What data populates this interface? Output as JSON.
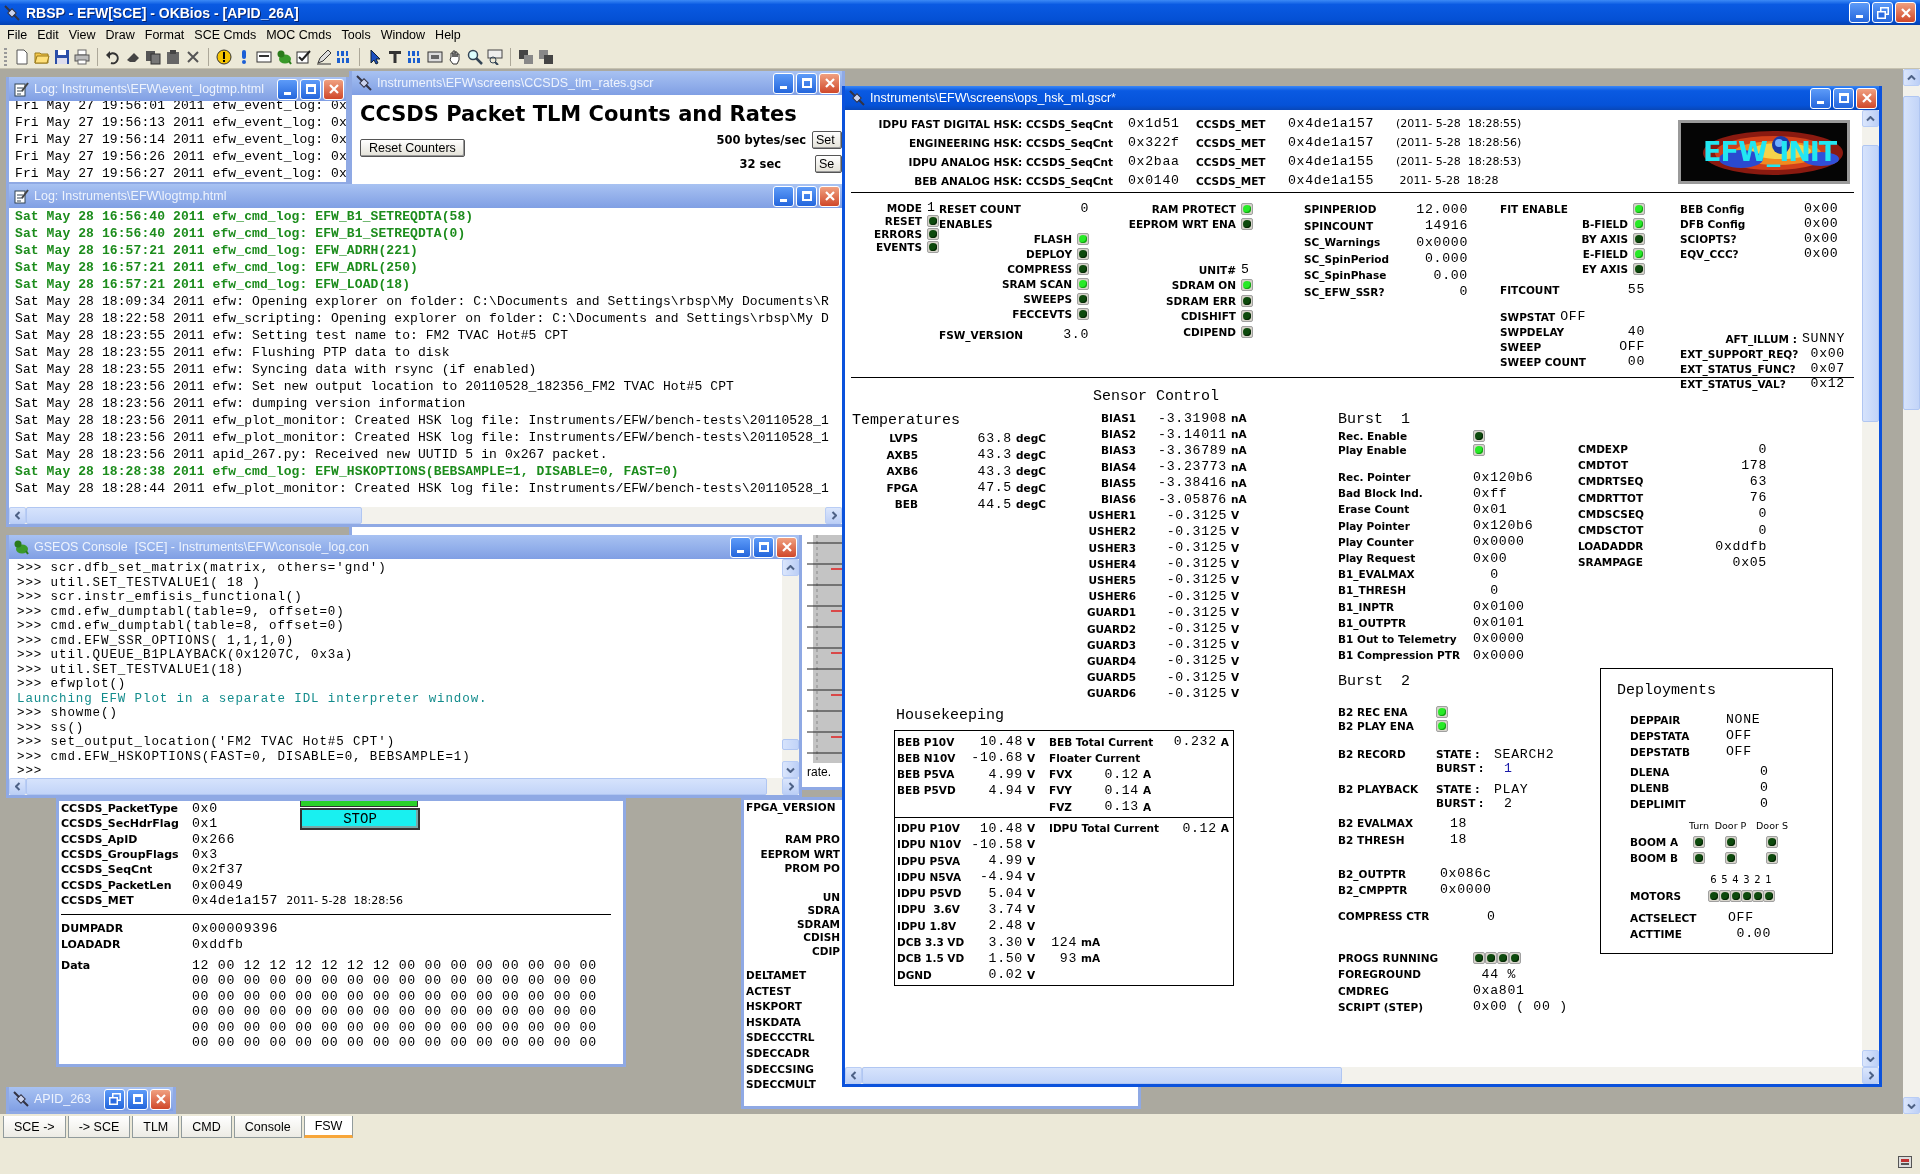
{
  "app": {
    "title": "RBSP - EFW[SCE] - OKBios - [APID_26A]",
    "menu": [
      "File",
      "Edit",
      "View",
      "Draw",
      "Format",
      "SCE Cmds",
      "MOC Cmds",
      "Tools",
      "Window",
      "Help"
    ]
  },
  "windows": [
    {
      "kind": "event_log",
      "title": "Log: Instruments\\EFW\\event_logtmp.html",
      "active": false,
      "lines": [
        {
          "text": "Fri May 27 19:56:01 2011 efw_event_log: 0x",
          "command": false
        },
        {
          "text": "Fri May 27 19:56:13 2011 efw_event_log: 0x",
          "command": false
        },
        {
          "text": "Fri May 27 19:56:14 2011 efw_event_log: 0x",
          "command": false
        },
        {
          "text": "Fri May 27 19:56:26 2011 efw_event_log: 0x",
          "command": false
        },
        {
          "text": "Fri May 27 19:56:27 2011 efw_event_log: 0x",
          "command": false
        }
      ]
    },
    {
      "kind": "tlm_rates",
      "title": "Instruments\\EFW\\screens\\CCSDS_tlm_rates.gscr",
      "active": false,
      "heading": "CCSDS Packet TLM Counts and Rates",
      "reset_button": "Reset Counters",
      "rates": [
        {
          "text": "500 bytes/sec",
          "button": "Set"
        },
        {
          "text": "32 sec",
          "button": "Se"
        }
      ],
      "caption": "rate."
    },
    {
      "kind": "log",
      "title": "Log: Instruments\\EFW\\logtmp.html",
      "active": false,
      "lines": [
        {
          "text": "Sat May 28 16:56:40 2011 efw_cmd_log: EFW_B1_SETREQDTA(58)",
          "command": true
        },
        {
          "text": "Sat May 28 16:56:40 2011 efw_cmd_log: EFW_B1_SETREQDTA(0)",
          "command": true
        },
        {
          "text": "Sat May 28 16:57:21 2011 efw_cmd_log: EFW_ADRH(221)",
          "command": true
        },
        {
          "text": "Sat May 28 16:57:21 2011 efw_cmd_log: EFW_ADRL(250)",
          "command": true
        },
        {
          "text": "Sat May 28 16:57:21 2011 efw_cmd_log: EFW_LOAD(18)",
          "command": true
        },
        {
          "text": "Sat May 28 18:09:34 2011 efw: Opening explorer on folder: C:\\Documents and Settings\\rbsp\\My Documents\\R",
          "command": false
        },
        {
          "text": "Sat May 28 18:22:58 2011 efw_scripting: Opening explorer on folder: C:\\Documents and Settings\\rbsp\\My D",
          "command": false
        },
        {
          "text": "Sat May 28 18:23:55 2011 efw: Setting test name to: FM2 TVAC Hot#5 CPT",
          "command": false
        },
        {
          "text": "Sat May 28 18:23:55 2011 efw: Flushing PTP data to disk",
          "command": false
        },
        {
          "text": "Sat May 28 18:23:55 2011 efw: Syncing data with rsync (if enabled)",
          "command": false
        },
        {
          "text": "Sat May 28 18:23:56 2011 efw: Set new output location to 20110528_182356_FM2 TVAC Hot#5 CPT",
          "command": false
        },
        {
          "text": "Sat May 28 18:23:56 2011 efw: dumping version information",
          "command": false
        },
        {
          "text": "Sat May 28 18:23:56 2011 efw_plot_monitor: Created HSK log file: Instruments/EFW/bench-tests\\20110528_1",
          "command": false
        },
        {
          "text": "Sat May 28 18:23:56 2011 efw_plot_monitor: Created HSK log file: Instruments/EFW/bench-tests\\20110528_1",
          "command": false
        },
        {
          "text": "Sat May 28 18:23:56 2011 apid_267.py: Received new UUTID 5 in 0x267 packet.",
          "command": false
        },
        {
          "text": "Sat May 28 18:28:38 2011 efw_cmd_log: EFW_HSKOPTIONS(BEBSAMPLE=1, DISABLE=0, FAST=0)",
          "command": true
        },
        {
          "text": "Sat May 28 18:28:44 2011 efw_plot_monitor: Created HSK log file: Instruments/EFW/bench-tests\\20110528_1",
          "command": false
        }
      ]
    },
    {
      "kind": "packet",
      "active": false,
      "fields": [
        {
          "label": "CCSDS_PacketType",
          "value": "0x0"
        },
        {
          "label": "CCSDS_SecHdrFlag",
          "value": "0x1"
        },
        {
          "label": "CCSDS_ApID",
          "value": "0x266"
        },
        {
          "label": "CCSDS_GroupFlags",
          "value": "0x3"
        },
        {
          "label": "CCSDS_SeqCnt",
          "value": "0x2f37"
        },
        {
          "label": "CCSDS_PacketLen",
          "value": "0x0049"
        },
        {
          "label": "CCSDS_MET",
          "value": "0x4de1a157",
          "time": "2011- 5-28  18:28:56"
        }
      ],
      "button": "STOP",
      "addresses": [
        {
          "label": "DUMPADR",
          "value": "0x00009396"
        },
        {
          "label": "LOADADR",
          "value": "0xddfb"
        }
      ],
      "data_label": "Data",
      "data": [
        "12 00 12 12 12 12 12 12 00 00 00 00 00 00 00 00",
        "00 00 00 00 00 00 00 00 00 00 00 00 00 00 00 00",
        "00 00 00 00 00 00 00 00 00 00 00 00 00 00 00 00",
        "00 00 00 00 00 00 00 00 00 00 00 00 00 00 00 00",
        "00 00 00 00 00 00 00 00 00 00 00 00 00 00 00 00",
        "00 00 00 00 00 00 00 00 00 00 00 00 00 00 00 00"
      ]
    },
    {
      "kind": "fsw",
      "active": false,
      "top_labels": [
        "FPGA_VERSION"
      ],
      "enable_labels": [
        "RAM PRO",
        "EEPROM WRT",
        "PROM PO"
      ],
      "unit_labels": [
        "UN",
        "SDRA",
        "SDRAM",
        "CDISH",
        "CDIP"
      ],
      "register_labels": [
        "DELTAMET",
        "ACTEST",
        "HSKPORT",
        "HSKDATA",
        "SDECCCTRL",
        "SDECCADR",
        "SDECCSING",
        "SDECCMULT"
      ]
    },
    {
      "kind": "console",
      "title": "GSEOS Console  [SCE] - Instruments\\EFW\\console_log.con",
      "active": false,
      "lines": [
        {
          "text": ">>> scr.dfb_set_matrix(matrix, others='gnd')",
          "output": false
        },
        {
          "text": ">>> util.SET_TESTVALUE1( 18 )",
          "output": false
        },
        {
          "text": ">>> scr.instr_emfisis_functional()",
          "output": false
        },
        {
          "text": ">>> cmd.efw_dumptabl(table=9, offset=0)",
          "output": false
        },
        {
          "text": ">>> cmd.efw_dumptabl(table=8, offset=0)",
          "output": false
        },
        {
          "text": ">>> cmd.EFW_SSR_OPTIONS( 1,1,1,0)",
          "output": false
        },
        {
          "text": ">>> util.QUEUE_B1PLAYBACK(0x1207C, 0x3a)",
          "output": false
        },
        {
          "text": ">>> util.SET_TESTVALUE1(18)",
          "output": false
        },
        {
          "text": ">>> efwplot()",
          "output": false
        },
        {
          "text": "Launching EFW Plot in a separate IDL interpreter window.",
          "output": true
        },
        {
          "text": ">>> showme()",
          "output": false
        },
        {
          "text": ">>> ss()",
          "output": false
        },
        {
          "text": ">>> set_output_location('FM2 TVAC Hot#5 CPT')",
          "output": false
        },
        {
          "text": ">>> cmd.EFW_HSKOPTIONS(FAST=0, DISABLE=0, BEBSAMPLE=1)",
          "output": false
        },
        {
          "text": ">>>",
          "output": false
        }
      ]
    },
    {
      "kind": "minimized",
      "title": "APID_263",
      "active": false
    },
    {
      "kind": "hsk",
      "title": "Instruments\\EFW\\screens\\ops_hsk_ml.gscr*",
      "active": true,
      "packets": [
        {
          "label": "IDPU FAST DIGITAL HSK: CCSDS_SeqCnt",
          "seq": "0x1d51",
          "met_label": "CCSDS_MET",
          "met": "0x4de1a157",
          "time": "(2011- 5-28  18:28:55)"
        },
        {
          "label": "ENGINEERING HSK: CCSDS_SeqCnt",
          "seq": "0x322f",
          "met_label": "CCSDS_MET",
          "met": "0x4de1a157",
          "time": "(2011- 5-28  18:28:56)"
        },
        {
          "label": "IDPU ANALOG HSK: CCSDS_SeqCnt",
          "seq": "0x2baa",
          "met_label": "CCSDS_MET",
          "met": "0x4de1a155",
          "time": "(2011- 5-28  18:28:53)"
        },
        {
          "label": "BEB ANALOG HSK: CCSDS_SeqCnt",
          "seq": "0x0140",
          "met_label": "CCSDS_MET",
          "met": "0x4de1a155",
          "time": " 2011- 5-28  18:28"
        }
      ],
      "logo": "EFW_INIT",
      "status_columns": [
        [
          {
            "kind": "value",
            "label": "MODE",
            "value": "1"
          },
          {
            "kind": "led",
            "label": "RESET",
            "on": false
          },
          {
            "kind": "led",
            "label": "ERRORS",
            "on": false
          },
          {
            "kind": "led",
            "label": "EVENTS",
            "on": false
          }
        ],
        [
          {
            "kind": "value",
            "label": "RESET COUNT",
            "value": "0"
          },
          {
            "kind": "heading",
            "label": "ENABLES"
          },
          {
            "kind": "led",
            "label": "FLASH",
            "on": true
          },
          {
            "kind": "led",
            "label": "DEPLOY",
            "on": false
          },
          {
            "kind": "led",
            "label": "COMPRESS",
            "on": false
          },
          {
            "kind": "led",
            "label": "SRAM SCAN",
            "on": true
          },
          {
            "kind": "led",
            "label": "SWEEPS",
            "on": false
          },
          {
            "kind": "led",
            "label": "FECCEVTS",
            "on": false
          },
          {
            "kind": "value",
            "label": "FSW_VERSION",
            "value": "3.0"
          }
        ],
        [
          {
            "kind": "led",
            "label": "RAM PROTECT",
            "on": true
          },
          {
            "kind": "led",
            "label": "EEPROM WRT ENA",
            "on": false
          },
          {
            "kind": "value",
            "label": "UNIT#",
            "value": "5"
          },
          {
            "kind": "led",
            "label": "SDRAM ON",
            "on": true
          },
          {
            "kind": "led",
            "label": "SDRAM ERR",
            "on": false
          },
          {
            "kind": "led",
            "label": "CDISHIFT",
            "on": false
          },
          {
            "kind": "led",
            "label": "CDIPEND",
            "on": false
          }
        ],
        [
          {
            "kind": "value",
            "label": "SPINPERIOD",
            "value": "12.000"
          },
          {
            "kind": "value",
            "label": "SPINCOUNT",
            "value": "14916"
          },
          {
            "kind": "value",
            "label": "SC_Warnings",
            "value": "0x0000"
          },
          {
            "kind": "value",
            "label": "SC_SpinPeriod",
            "value": "0.000"
          },
          {
            "kind": "value",
            "label": "SC_SpinPhase",
            "value": "0.00"
          },
          {
            "kind": "value",
            "label": "SC_EFW_SSR?",
            "value": "0"
          }
        ],
        [
          {
            "kind": "led",
            "label": "FIT ENABLE",
            "on": true
          },
          {
            "kind": "led",
            "label": "B-FIELD",
            "on": true
          },
          {
            "kind": "led",
            "label": "BY AXIS",
            "on": false
          },
          {
            "kind": "led",
            "label": "E-FIELD",
            "on": true
          },
          {
            "kind": "led",
            "label": "EY AXIS",
            "on": false
          },
          {
            "kind": "value",
            "label": "FITCOUNT",
            "value": "55"
          },
          {
            "kind": "value",
            "label": "SWPSTAT",
            "value": "OFF"
          },
          {
            "kind": "value",
            "label": "SWPDELAY",
            "value": "40"
          },
          {
            "kind": "value",
            "label": "SWEEP",
            "value": "OFF"
          },
          {
            "kind": "value",
            "label": "SWEEP COUNT",
            "value": "00"
          }
        ],
        [
          {
            "kind": "value",
            "label": "BEB Config",
            "value": "0x00"
          },
          {
            "kind": "value",
            "label": "DFB Config",
            "value": "0x00"
          },
          {
            "kind": "value",
            "label": "SCIOPTS?",
            "value": "0x00"
          },
          {
            "kind": "value",
            "label": "EQV_CCC?",
            "value": "0x00"
          },
          {
            "kind": "value",
            "label": "AFT_ILLUM :",
            "value": "SUNNY"
          },
          {
            "kind": "value",
            "label": "EXT_SUPPORT_REQ?",
            "value": "0x00"
          },
          {
            "kind": "value",
            "label": "EXT_STATUS_FUNC?",
            "value": "0x07"
          },
          {
            "kind": "value",
            "label": "EXT_STATUS_VAL?",
            "value": "0x12"
          }
        ]
      ],
      "temperatures": {
        "title": "Temperatures",
        "rows": [
          {
            "label": "LVPS",
            "value": "63.8",
            "unit": "degC"
          },
          {
            "label": "AXB5",
            "value": "43.3",
            "unit": "degC"
          },
          {
            "label": "AXB6",
            "value": "43.3",
            "unit": "degC"
          },
          {
            "label": "FPGA",
            "value": "47.5",
            "unit": "degC"
          },
          {
            "label": "BEB",
            "value": "44.5",
            "unit": "degC"
          }
        ]
      },
      "sensor_control": {
        "title": "Sensor Control",
        "rows": [
          {
            "label": "BIAS1",
            "value": "-3.31908",
            "unit": "nA"
          },
          {
            "label": "BIAS2",
            "value": "-3.14011",
            "unit": "nA"
          },
          {
            "label": "BIAS3",
            "value": "-3.36789",
            "unit": "nA"
          },
          {
            "label": "BIAS4",
            "value": "-3.23773",
            "unit": "nA"
          },
          {
            "label": "BIAS5",
            "value": "-3.38416",
            "unit": "nA"
          },
          {
            "label": "BIAS6",
            "value": "-3.05876",
            "unit": "nA"
          },
          {
            "label": "USHER1",
            "value": "-0.3125",
            "unit": "V"
          },
          {
            "label": "USHER2",
            "value": "-0.3125",
            "unit": "V"
          },
          {
            "label": "USHER3",
            "value": "-0.3125",
            "unit": "V"
          },
          {
            "label": "USHER4",
            "value": "-0.3125",
            "unit": "V"
          },
          {
            "label": "USHER5",
            "value": "-0.3125",
            "unit": "V"
          },
          {
            "label": "USHER6",
            "value": "-0.3125",
            "unit": "V"
          },
          {
            "label": "GUARD1",
            "value": "-0.3125",
            "unit": "V"
          },
          {
            "label": "GUARD2",
            "value": "-0.3125",
            "unit": "V"
          },
          {
            "label": "GUARD3",
            "value": "-0.3125",
            "unit": "V"
          },
          {
            "label": "GUARD4",
            "value": "-0.3125",
            "unit": "V"
          },
          {
            "label": "GUARD5",
            "value": "-0.3125",
            "unit": "V"
          },
          {
            "label": "GUARD6",
            "value": "-0.3125",
            "unit": "V"
          }
        ]
      },
      "housekeeping": {
        "title": "Housekeeping",
        "beb": [
          {
            "label": "BEB P10V",
            "value": "10.48",
            "unit": "V"
          },
          {
            "label": "BEB N10V",
            "value": "-10.68",
            "unit": "V"
          },
          {
            "label": "BEB P5VA",
            "value": "4.99",
            "unit": "V"
          },
          {
            "label": "BEB P5VD",
            "value": "4.94",
            "unit": "V"
          }
        ],
        "beb_total": {
          "label": "BEB Total Current",
          "value": "0.232",
          "unit": "A"
        },
        "floater_title": "Floater Current",
        "floater": [
          {
            "label": "FVX",
            "value": "0.12",
            "unit": "A"
          },
          {
            "label": "FVY",
            "value": "0.14",
            "unit": "A"
          },
          {
            "label": "FVZ",
            "value": "0.13",
            "unit": "A"
          }
        ],
        "idpu": [
          {
            "label": "IDPU P10V",
            "value": "10.48",
            "unit": "V"
          },
          {
            "label": "IDPU N10V",
            "value": "-10.58",
            "unit": "V"
          },
          {
            "label": "IDPU P5VA",
            "value": "4.99",
            "unit": "V"
          },
          {
            "label": "IDPU N5VA",
            "value": "-4.94",
            "unit": "V"
          },
          {
            "label": "IDPU P5VD",
            "value": "5.04",
            "unit": "V"
          },
          {
            "label": "IDPU  3.6V",
            "value": "3.74",
            "unit": "V"
          },
          {
            "label": "IDPU 1.8V",
            "value": "2.48",
            "unit": "V"
          },
          {
            "label": "DCB 3.3 VD",
            "value": "3.30",
            "unit": "V",
            "current": "124",
            "current_unit": "mA"
          },
          {
            "label": "DCB 1.5 VD",
            "value": "1.50",
            "unit": "V",
            "current": "93",
            "current_unit": "mA"
          },
          {
            "label": "DGND",
            "value": "0.02",
            "unit": "V"
          }
        ],
        "idpu_total": {
          "label": "IDPU Total Current",
          "value": "0.12",
          "unit": "A"
        }
      },
      "burst1": {
        "title": "Burst  1",
        "leds": [
          {
            "label": "Rec. Enable",
            "on": false
          },
          {
            "label": "Play Enable",
            "on": true
          }
        ],
        "rows": [
          {
            "label": "Rec. Pointer",
            "value": "0x120b6"
          },
          {
            "label": "Bad Block Ind.",
            "value": "0xff"
          },
          {
            "label": "Erase Count",
            "value": "0x01"
          },
          {
            "label": "Play Pointer",
            "value": "0x120b6"
          },
          {
            "label": "Play Counter",
            "value": "0x0000"
          },
          {
            "label": "Play Request",
            "value": "0x00"
          },
          {
            "label": "B1_EVALMAX",
            "value": "  0"
          },
          {
            "label": "B1_THRESH",
            "value": "  0"
          },
          {
            "label": "B1_INPTR",
            "value": "0x0100"
          },
          {
            "label": "B1_OUTPTR",
            "value": "0x0101"
          },
          {
            "label": "B1 Out to Telemetry",
            "value": "0x0000"
          },
          {
            "label": "B1 Compression PTR",
            "value": "0x0000"
          }
        ]
      },
      "burst2": {
        "title": "Burst  2",
        "leds": [
          {
            "label": "B2 REC ENA",
            "on": true
          },
          {
            "label": "B2 PLAY ENA",
            "on": true
          }
        ],
        "modes": [
          {
            "label": "B2 RECORD",
            "state_label": "STATE :",
            "state": "SEARCH2",
            "burst_label": "BURST :",
            "burst": "1",
            "color": "#1a1aa8"
          },
          {
            "label": "B2 PLAYBACK",
            "state_label": "STATE :",
            "state": "PLAY",
            "burst_label": "BURST :",
            "burst": "2",
            "color": "#000000"
          }
        ],
        "thresholds": [
          {
            "label": "B2 EVALMAX",
            "value": "18"
          },
          {
            "label": "B2 THRESH",
            "value": "18"
          }
        ],
        "pointers": [
          {
            "label": "B2_OUTPTR",
            "value": "0x086c"
          },
          {
            "label": "B2_CMPPTR",
            "value": "0x0000"
          }
        ],
        "compress": {
          "label": "COMPRESS CTR",
          "value": "0"
        }
      },
      "programs": {
        "label": "PROGS RUNNING",
        "leds": [
          false,
          false,
          false,
          false
        ],
        "rows": [
          {
            "label": "FOREGROUND",
            "value": " 44 %"
          },
          {
            "label": "CMDREG",
            "value": "0xa801"
          },
          {
            "label": "SCRIPT (STEP)",
            "value": "0x00 ( 00 )"
          }
        ]
      },
      "commands": [
        {
          "label": "CMDEXP",
          "value": "0"
        },
        {
          "label": "CMDTOT",
          "value": "178"
        },
        {
          "label": "CMDRTSEQ",
          "value": "63"
        },
        {
          "label": "CMDRTTOT",
          "value": "76"
        },
        {
          "label": "CMDSCSEQ",
          "value": "0"
        },
        {
          "label": "CMDSCTOT",
          "value": "0"
        },
        {
          "label": "LOADADDR",
          "value": "0xddfb"
        },
        {
          "label": "SRAMPAGE",
          "value": "0x05"
        }
      ],
      "deployments": {
        "title": "Deployments",
        "states": [
          {
            "label": "DEPPAIR",
            "value": "NONE"
          },
          {
            "label": "DEPSTATA",
            "value": "OFF"
          },
          {
            "label": "DEPSTATB",
            "value": "OFF"
          }
        ],
        "limits": [
          {
            "label": "DLENA",
            "value": "0"
          },
          {
            "label": "DLENB",
            "value": "0"
          },
          {
            "label": "DEPLIMIT",
            "value": "0"
          }
        ],
        "boom_columns": [
          "Turn",
          "Door P",
          "Door S"
        ],
        "booms": [
          {
            "label": "BOOM A",
            "leds": [
              false,
              false,
              false
            ]
          },
          {
            "label": "BOOM B",
            "leds": [
              false,
              false,
              false
            ]
          }
        ],
        "motor_numbers": [
          "6",
          "5",
          "4",
          "3",
          "2",
          "1"
        ],
        "motors": {
          "label": "MOTORS",
          "leds": [
            false,
            false,
            false,
            false,
            false,
            false
          ]
        },
        "actuator": [
          {
            "label": "ACTSELECT",
            "value": "OFF"
          },
          {
            "label": "ACTTIME",
            "value": " 0.00"
          }
        ]
      }
    }
  ],
  "tabs": [
    {
      "label": "SCE ->",
      "selected": false
    },
    {
      "label": "-> SCE",
      "selected": false
    },
    {
      "label": "TLM",
      "selected": false
    },
    {
      "label": "CMD",
      "selected": false
    },
    {
      "label": "Console",
      "selected": false
    },
    {
      "label": "FSW",
      "selected": true
    }
  ]
}
